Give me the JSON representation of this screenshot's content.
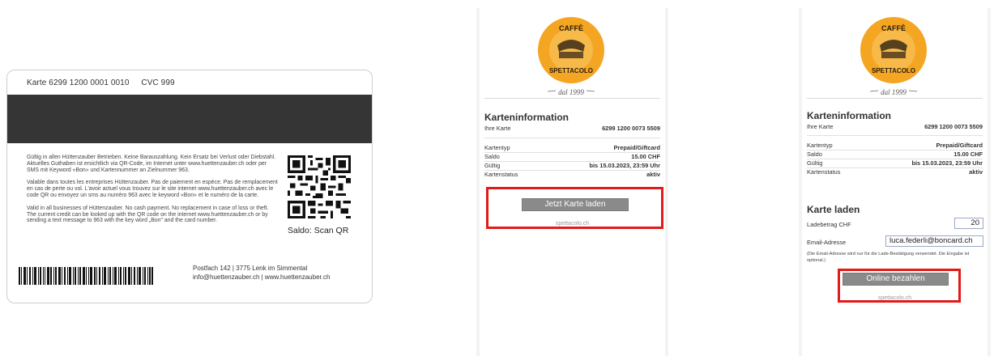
{
  "card": {
    "number_label": "Karte 6299 1200 0001 0010",
    "cvc_label": "CVC 999",
    "text_de": "Gültig in allen Hüttenzauber Betrieben. Keine Barauszahlung. Kein Ersatz bei Verlust oder Diebstahl. Aktuelles Guthaben ist ersichtlich via QR-Code, im Internet unter www.huettenzauber.ch oder per SMS mit Keyword «Bon» und Kartennummer an Zielnummer 963.",
    "text_fr": "Valable dans toutes les entreprises Hüttenzauber. Pas de paiement en espèce. Pas de remplacement en cas de perte ou vol. L'avoir actuel vous trouvez sur le site internet www.huettenzauber.ch avec le code QR ou envoyez un sms au numéro 963 avec le keyword «Bon» et le numéro de la carte.",
    "text_en": "Valid in all businesses of Hüttenzauber. No cash payment. No replacement in case of loss or theft. The current credit can be looked up with the QR code on the internet www.huettenzauber.ch or by sending a text message to 963 with the key word „Bon\" and the card number.",
    "saldo_qr": "Saldo: Scan QR",
    "address_line1": "Postfach 142 | 3775 Lenk im Simmental",
    "address_line2": "info@huettenzauber.ch | www.huettenzauber.ch"
  },
  "logo": {
    "top_text": "CAFFÈ",
    "arc_text": "SPETTACOLO",
    "tagline": "dal 1999"
  },
  "panel1": {
    "section_title": "Karteninformation",
    "card_label": "Ihre Karte",
    "card_value": "6299 1200 0073 5509",
    "rows": [
      {
        "label": "Kartentyp",
        "value": "Prepaid/Giftcard"
      },
      {
        "label": "Saldo",
        "value": "15.00 CHF"
      },
      {
        "label": "Gültig",
        "value": "bis 15.03.2023, 23:59 Uhr"
      },
      {
        "label": "Kartenstatus",
        "value": "aktiv"
      }
    ],
    "load_button": "Jetzt Karte laden",
    "footer": "spettacolo.ch"
  },
  "panel2": {
    "section_title": "Karteninformation",
    "card_label": "Ihre Karte",
    "card_value": "6299 1200 0073 5509",
    "rows": [
      {
        "label": "Kartentyp",
        "value": "Prepaid/Giftcard"
      },
      {
        "label": "Saldo",
        "value": "15.00 CHF"
      },
      {
        "label": "Gültig",
        "value": "bis 15.03.2023, 23:59 Uhr"
      },
      {
        "label": "Kartenstatus",
        "value": "aktiv"
      }
    ],
    "load_section_title": "Karte laden",
    "amount_label": "Ladebetrag CHF",
    "amount_value": "20",
    "email_label": "Email-Adresse",
    "email_value": "luca.federli@boncard.ch",
    "email_note": "(Die Email-Adresse wird nur für die Lade-Bestätigung verwendet. Die Eingabe ist optional.)",
    "pay_button": "Online bezahlen",
    "footer": "spettacolo.ch"
  },
  "colors": {
    "highlight": "#e41a1a",
    "logo_orange": "#f4a623",
    "button_gray": "#8a8a8a",
    "stripe": "#353535"
  }
}
